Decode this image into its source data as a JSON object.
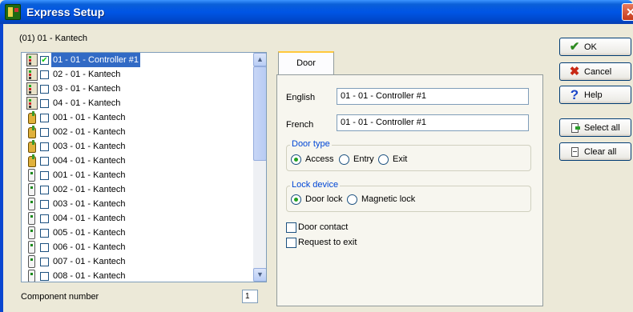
{
  "window": {
    "title": "Express Setup",
    "close_glyph": "✕"
  },
  "group_title": "(01) 01 - Kantech",
  "tree": {
    "items": [
      {
        "icon": "controller-icon",
        "checked": true,
        "label": "01 - 01 - Controller #1",
        "selected": true
      },
      {
        "icon": "controller-icon",
        "checked": false,
        "label": "02 - 01 - Kantech"
      },
      {
        "icon": "controller-icon",
        "checked": false,
        "label": "03 - 01 - Kantech"
      },
      {
        "icon": "controller-icon",
        "checked": false,
        "label": "04 - 01 - Kantech"
      },
      {
        "icon": "door-hand-icon",
        "checked": false,
        "label": "001 - 01 - Kantech"
      },
      {
        "icon": "door-hand-icon",
        "checked": false,
        "label": "002 - 01 - Kantech"
      },
      {
        "icon": "door-hand-icon",
        "checked": false,
        "label": "003 - 01 - Kantech"
      },
      {
        "icon": "door-hand-icon",
        "checked": false,
        "label": "004 - 01 - Kantech"
      },
      {
        "icon": "reader-icon",
        "checked": false,
        "label": "001 - 01 - Kantech"
      },
      {
        "icon": "reader-icon",
        "checked": false,
        "label": "002 - 01 - Kantech"
      },
      {
        "icon": "reader-icon",
        "checked": false,
        "label": "003 - 01 - Kantech"
      },
      {
        "icon": "reader-icon",
        "checked": false,
        "label": "004 - 01 - Kantech"
      },
      {
        "icon": "reader-icon",
        "checked": false,
        "label": "005 - 01 - Kantech"
      },
      {
        "icon": "reader-icon",
        "checked": false,
        "label": "006 - 01 - Kantech"
      },
      {
        "icon": "reader-icon",
        "checked": false,
        "label": "007 - 01 - Kantech"
      },
      {
        "icon": "reader-icon",
        "checked": false,
        "label": "008 - 01 - Kantech"
      }
    ],
    "scroll_up_glyph": "▲",
    "scroll_down_glyph": "▼"
  },
  "component_number": {
    "label": "Component number",
    "value": "1"
  },
  "tab": {
    "label": "Door"
  },
  "form": {
    "english_label": "English",
    "english_value": "01 - 01 - Controller #1",
    "french_label": "French",
    "french_value": "01 - 01 - Controller #1",
    "door_type": {
      "legend": "Door type",
      "options": [
        "Access",
        "Entry",
        "Exit"
      ],
      "selected": "Access"
    },
    "lock_device": {
      "legend": "Lock device",
      "options": [
        "Door lock",
        "Magnetic lock"
      ],
      "selected": "Door lock"
    },
    "door_contact_label": "Door contact",
    "door_contact_checked": false,
    "request_to_exit_label": "Request to exit",
    "request_to_exit_checked": false
  },
  "buttons": {
    "ok_label": "OK",
    "cancel_label": "Cancel",
    "help_label": "Help",
    "select_all_label": "Select all",
    "clear_all_label": "Clear all",
    "ok_glyph": "✔",
    "cancel_glyph": "✖",
    "help_glyph": "?"
  },
  "colors": {
    "titlebar": "#0055e5",
    "selection": "#316ac5",
    "legend_text": "#0046d5",
    "radio_dot": "#21a121"
  }
}
